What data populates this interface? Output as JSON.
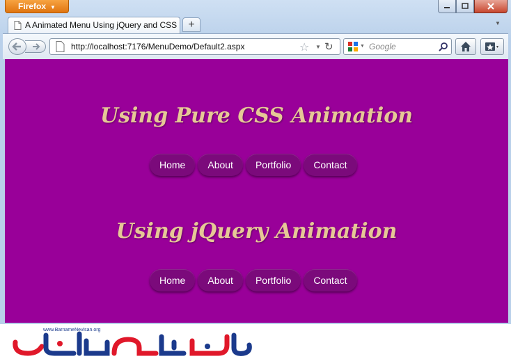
{
  "browser": {
    "menu_button": "Firefox",
    "tab_title": "A Animated Menu Using jQuery and CSS",
    "url": "http://localhost:7176/MenuDemo/Default2.aspx",
    "search_placeholder": "Google"
  },
  "page": {
    "background": "#990099",
    "heading_color": "#e6c896",
    "section_css": {
      "heading": "Using Pure CSS Animation",
      "menu": [
        "Home",
        "About",
        "Portfolio",
        "Contact"
      ]
    },
    "section_jquery": {
      "heading": "Using jQuery Animation",
      "menu": [
        "Home",
        "About",
        "Portfolio",
        "Contact"
      ]
    }
  },
  "watermark": {
    "site": "www.BarnameNevisan.org"
  }
}
